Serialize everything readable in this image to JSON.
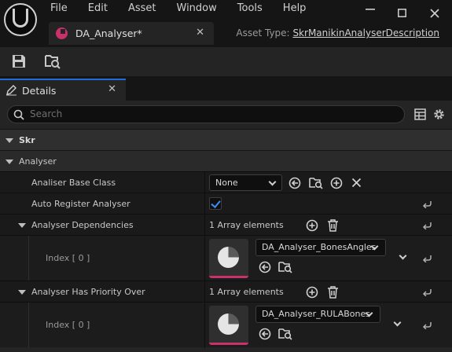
{
  "menu": [
    "File",
    "Edit",
    "Asset",
    "Window",
    "Tools",
    "Help"
  ],
  "asset_tab": {
    "label": "DA_Analyser*",
    "close": "✕"
  },
  "asset_type": {
    "prefix": "Asset Type:",
    "value": "SkrManikinAnalyserDescription"
  },
  "details_tab": {
    "label": "Details",
    "close": "✕"
  },
  "search": {
    "placeholder": "Search"
  },
  "categories": {
    "skr": "Skr",
    "analyser": "Analyser"
  },
  "props": {
    "base_class": {
      "label": "Analiser Base Class",
      "value": "None"
    },
    "auto_register": {
      "label": "Auto Register Analyser",
      "checked": true
    },
    "dependencies": {
      "label": "Analyser Dependencies",
      "count": "1 Array elements",
      "index_label": "Index [ 0 ]",
      "value": "DA_Analyser_BonesAngles"
    },
    "priority": {
      "label": "Analyser Has Priority Over",
      "count": "1 Array elements",
      "index_label": "Index [ 0 ]",
      "value": "DA_Analyser_RULABones"
    }
  },
  "icons": [
    "engine-logo",
    "save-icon",
    "browse-asset-icon",
    "pencil-icon",
    "search-icon",
    "table-view-icon",
    "gear-icon",
    "use-selected-icon",
    "browse-icon",
    "add-icon",
    "clear-icon",
    "delete-icon",
    "reset-arrow-icon"
  ],
  "colors": {
    "accent": "#1d6ed6",
    "asset_pink": "#c8316a",
    "check_blue": "#3a8dff"
  }
}
